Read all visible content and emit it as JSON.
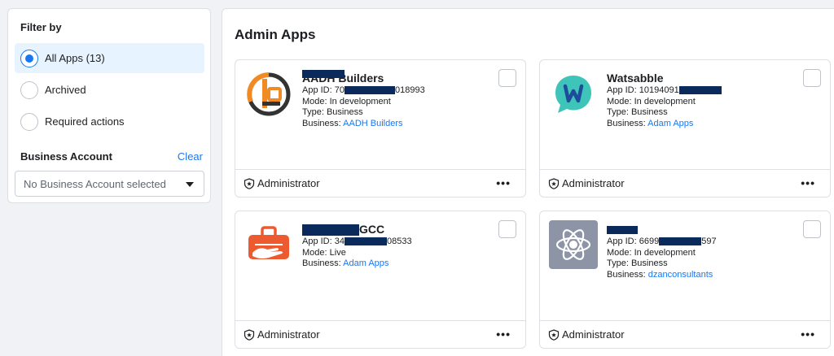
{
  "filter": {
    "title": "Filter by",
    "options": [
      {
        "label": "All Apps (13)",
        "selected": true
      },
      {
        "label": "Archived",
        "selected": false
      },
      {
        "label": "Required actions",
        "selected": false
      }
    ],
    "business_account": {
      "label": "Business Account",
      "clear": "Clear",
      "placeholder": "No Business Account selected"
    }
  },
  "main": {
    "title": "Admin Apps",
    "apps": [
      {
        "name": "AADH Builders",
        "app_id": "App ID: 70",
        "app_id_suffix": "018993",
        "mode": "Mode: In development",
        "type": "Type: Business",
        "business_prefix": "Business: ",
        "business": "AADH Builders",
        "role": "Administrator",
        "more": "•••"
      },
      {
        "name": "Watsabble",
        "app_id": "App ID: 10194091",
        "app_id_suffix": "",
        "mode": "Mode: In development",
        "type": "Type: Business",
        "business_prefix": "Business: ",
        "business": "Adam Apps",
        "role": "Administrator",
        "more": "•••"
      },
      {
        "name": "GCC",
        "app_id": "App ID: 34",
        "app_id_suffix": "08533",
        "mode": "Mode: Live",
        "type": "",
        "business_prefix": "Business: ",
        "business": "Adam Apps",
        "role": "Administrator",
        "more": "•••"
      },
      {
        "name": "",
        "app_id": "App ID: 6699",
        "app_id_suffix": "597",
        "mode": "Mode: In development",
        "type": "Type: Business",
        "business_prefix": "Business: ",
        "business": "dzanconsultants",
        "role": "Administrator",
        "more": "•••"
      }
    ]
  },
  "colors": {
    "accent": "#1877f2",
    "redaction": "#0a2a5c",
    "aadh_orange": "#f08a24",
    "watsabble_teal": "#3ec4b8",
    "gcc_orange": "#ee5a2f"
  },
  "icons": [
    "radio-selected",
    "radio-unselected",
    "caret-down-icon",
    "shield-star-icon",
    "more-icon"
  ]
}
